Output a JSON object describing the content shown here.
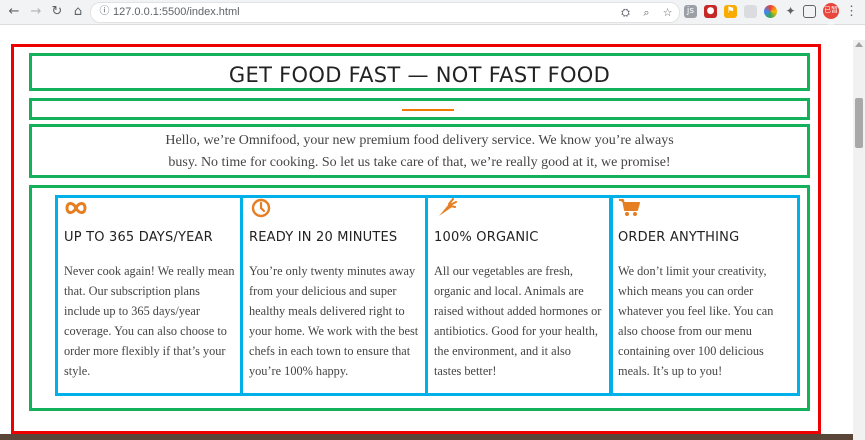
{
  "browser": {
    "url": "127.0.0.1:5500/index.html",
    "nav": {
      "back": "←",
      "forward": "→",
      "reload": "↻",
      "home": "⌂"
    },
    "icons": [
      "translate-icon",
      "zoom-icon",
      "bookmark-star-icon"
    ],
    "extensions": [
      "extension-js",
      "extension-red",
      "extension-flag",
      "extension-box",
      "extension-colorwheel",
      "puzzle-icon",
      "sidebar-icon"
    ],
    "avatar_label": "已暂停"
  },
  "section": {
    "heading": "GET FOOD FAST — NOT FAST FOOD",
    "intro_lines": [
      "Hello, we’re Omnifood, your new premium food delivery service. We know you’re always",
      "busy. No time for cooking. So let us take care of that, we’re really good at it, we promise!"
    ],
    "features": [
      {
        "icon": "infinity-icon",
        "title": "UP TO 365 DAYS/YEAR",
        "lines": [
          "Never cook again! We really mean",
          "that. Our subscription plans",
          "include up to 365 days/year",
          "coverage. You can also choose to",
          "order more flexibly if that’s your",
          "style."
        ]
      },
      {
        "icon": "clock-icon",
        "title": "READY IN 20 MINUTES",
        "lines": [
          "You’re only twenty minutes away",
          "from your delicious and super",
          "healthy meals delivered right to",
          "your home. We work with the best",
          "chefs in each town to ensure that",
          "you’re 100% happy."
        ]
      },
      {
        "icon": "carrot-icon",
        "title": "100% ORGANIC",
        "lines": [
          "All our vegetables are fresh,",
          "organic and local. Animals are",
          "raised without added hormones or",
          "antibiotics. Good for your health,",
          "the environment, and it also",
          "tastes better!"
        ]
      },
      {
        "icon": "cart-icon",
        "title": "ORDER ANYTHING",
        "lines": [
          "We don’t limit your creativity,",
          "which means you can order",
          "whatever you feel like. You can",
          "also choose from our menu",
          "containing over 100 delicious",
          "meals. It’s up to you!"
        ]
      }
    ]
  },
  "colors": {
    "accent": "#e67e22",
    "outline_red": "#ee0000",
    "outline_green": "#14b05b",
    "outline_blue": "#00b0e8"
  }
}
